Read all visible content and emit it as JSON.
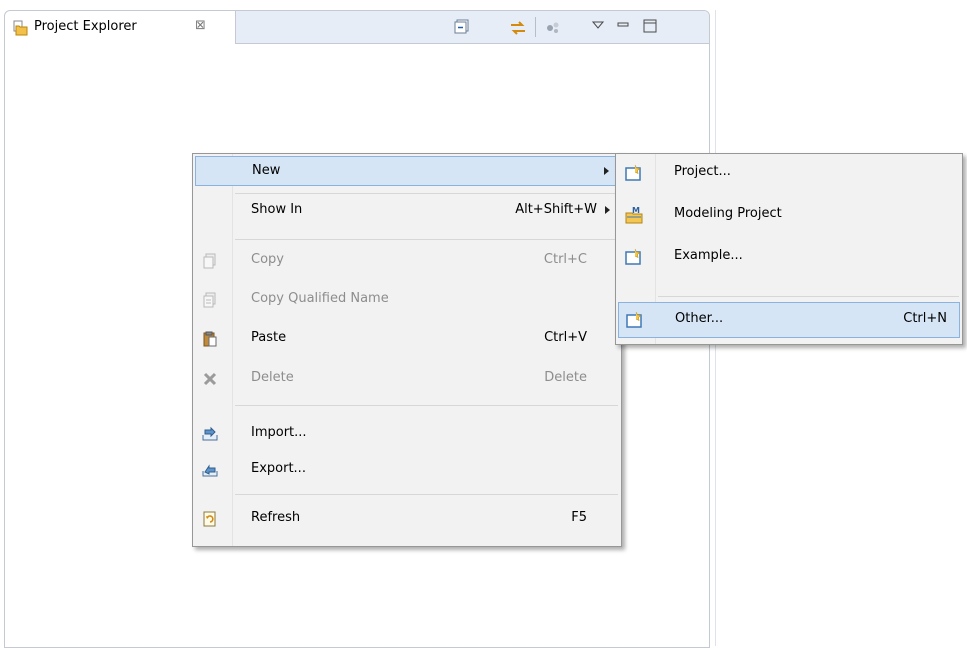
{
  "view": {
    "tab_title": "Project Explorer",
    "close_glyph": "⊠",
    "toolbar_icons": [
      "collapse-all-icon",
      "link-with-editor-icon",
      "filters-icon",
      "view-menu-icon",
      "minimize-icon",
      "maximize-icon"
    ]
  },
  "context_menu": {
    "items": [
      {
        "label": "New",
        "accelerator": "",
        "submenu": true,
        "enabled": true,
        "highlighted": true,
        "icon": null
      },
      {
        "label": "Show In",
        "accelerator": "Alt+Shift+W",
        "submenu": true,
        "enabled": true,
        "icon": null
      },
      {
        "label": "Copy",
        "accelerator": "Ctrl+C",
        "enabled": false,
        "icon": "copy-icon"
      },
      {
        "label": "Copy Qualified Name",
        "accelerator": "",
        "enabled": false,
        "icon": "copy-qualified-name-icon"
      },
      {
        "label": "Paste",
        "accelerator": "Ctrl+V",
        "enabled": true,
        "icon": "paste-icon"
      },
      {
        "label": "Delete",
        "accelerator": "Delete",
        "enabled": false,
        "icon": "delete-icon"
      },
      {
        "label": "Import...",
        "accelerator": "",
        "enabled": true,
        "icon": "import-icon"
      },
      {
        "label": "Export...",
        "accelerator": "",
        "enabled": true,
        "icon": "export-icon"
      },
      {
        "label": "Refresh",
        "accelerator": "F5",
        "enabled": true,
        "icon": "refresh-icon"
      }
    ]
  },
  "submenu_new": {
    "items": [
      {
        "label": "Project...",
        "accelerator": "",
        "icon": "new-project-icon"
      },
      {
        "label": "Modeling Project",
        "accelerator": "",
        "icon": "modeling-project-icon"
      },
      {
        "label": "Example...",
        "accelerator": "",
        "icon": "new-example-icon"
      },
      {
        "label": "Other...",
        "accelerator": "Ctrl+N",
        "icon": "new-other-icon",
        "highlighted": true
      }
    ]
  }
}
